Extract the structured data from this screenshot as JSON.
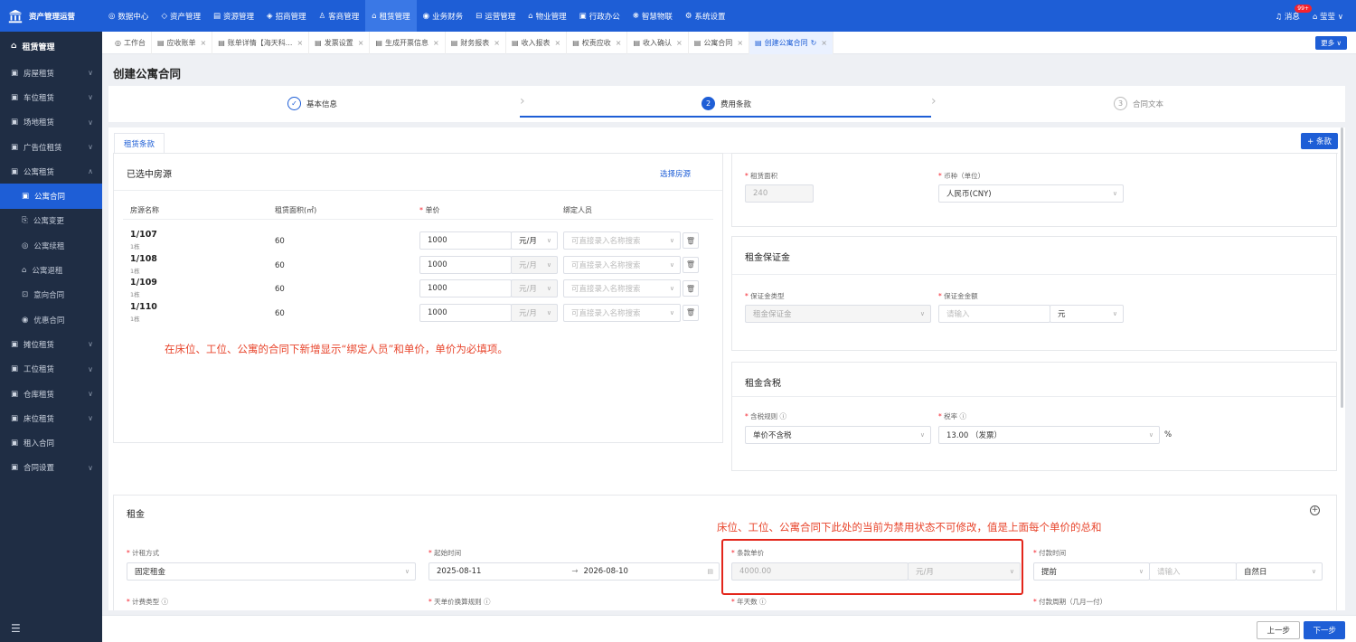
{
  "app": {
    "logo_text": "资产管理运营"
  },
  "topnav": [
    {
      "icon": "◎",
      "label": "数据中心"
    },
    {
      "icon": "◇",
      "label": "资产管理"
    },
    {
      "icon": "▤",
      "label": "资源管理"
    },
    {
      "icon": "◈",
      "label": "招商管理"
    },
    {
      "icon": "♙",
      "label": "客商管理"
    },
    {
      "icon": "⌂",
      "label": "租赁管理"
    },
    {
      "icon": "◉",
      "label": "业务财务"
    },
    {
      "icon": "⊟",
      "label": "运营管理"
    },
    {
      "icon": "⌂",
      "label": "物业管理"
    },
    {
      "icon": "▣",
      "label": "行政办公"
    },
    {
      "icon": "❋",
      "label": "智慧物联"
    },
    {
      "icon": "⚙",
      "label": "系统设置"
    }
  ],
  "topright": {
    "msg_label": "消息",
    "msg_count": "99+",
    "user": "莹莹"
  },
  "sidebar": {
    "header": "租赁管理",
    "items": [
      {
        "label": "房屋租赁",
        "chev": "∨"
      },
      {
        "label": "车位租赁",
        "chev": "∨"
      },
      {
        "label": "场地租赁",
        "chev": "∨"
      },
      {
        "label": "广告位租赁",
        "chev": "∨"
      },
      {
        "label": "公寓租赁",
        "chev": "∧"
      }
    ],
    "subs": [
      {
        "icon": "▣",
        "label": "公寓合同"
      },
      {
        "icon": "⎘",
        "label": "公寓变更"
      },
      {
        "icon": "◎",
        "label": "公寓续租"
      },
      {
        "icon": "⌂",
        "label": "公寓退租"
      },
      {
        "icon": "⊡",
        "label": "意向合同"
      },
      {
        "icon": "◉",
        "label": "优惠合同"
      }
    ],
    "items2": [
      {
        "label": "摊位租赁",
        "chev": "∨"
      },
      {
        "label": "工位租赁",
        "chev": "∨"
      },
      {
        "label": "仓库租赁",
        "chev": "∨"
      },
      {
        "label": "床位租赁",
        "chev": "∨"
      },
      {
        "label": "租入合同",
        "chev": ""
      },
      {
        "label": "合同设置",
        "chev": "∨"
      }
    ]
  },
  "tabs": [
    "工作台",
    "应收账单",
    "账单详情【海天科...",
    "发票设置",
    "生成开票信息",
    "财务报表",
    "收入报表",
    "权责应收",
    "收入确认",
    "公寓合同",
    "创建公寓合同"
  ],
  "more_label": "更多 ∨",
  "page_title": "创建公寓合同",
  "steps": [
    {
      "label": "基本信息",
      "num": "✓"
    },
    {
      "label": "费用条款",
      "num": "2"
    },
    {
      "label": "合同文本",
      "num": "3"
    }
  ],
  "subtab": "租赁条款",
  "add_label": "+ 条款",
  "rooms": {
    "title": "已选中房源",
    "select_link": "选择房源",
    "headers": [
      "房源名称",
      "租赁面积(㎡)",
      "单价",
      "绑定人员"
    ],
    "unit_options": "元/月",
    "person_placeholder": "可直接录入名称搜索",
    "rows": [
      {
        "name": "1/107",
        "building": "1栋",
        "area": "60",
        "price": "1000"
      },
      {
        "name": "1/108",
        "building": "1栋",
        "area": "60",
        "price": "1000"
      },
      {
        "name": "1/109",
        "building": "1栋",
        "area": "60",
        "price": "1000"
      },
      {
        "name": "1/110",
        "building": "1栋",
        "area": "60",
        "price": "1000"
      }
    ],
    "note": "在床位、工位、公寓的合同下新增显示“绑定人员”和单价，单价为必填项。"
  },
  "right": {
    "area_label": "租赁面积",
    "area_value": "240",
    "currency_label": "币种（单位）",
    "currency_value": "人民币(CNY)",
    "deposit_title": "租金保证金",
    "deposit_type_label": "保证金类型",
    "deposit_type_value": "租金保证金",
    "deposit_amt_label": "保证金金额",
    "deposit_amt_placeholder": "请输入",
    "deposit_unit": "元",
    "tax_title": "租金含税",
    "tax_rule_label": "含税规则",
    "tax_rule_value": "单价不含税",
    "tax_rate_label": "税率",
    "tax_rate_value": "13.00 （发票）",
    "tax_pct": "%"
  },
  "rent": {
    "title": "租金",
    "note": "床位、工位、公寓合同下此处的当前为禁用状态不可修改，值是上面每个单价的总和",
    "method_label": "计租方式",
    "method_value": "固定租金",
    "time_label": "起始时间",
    "start": "2025-08-11",
    "arrow": "→",
    "end": "2026-08-10",
    "price_label": "条款单价",
    "price_value": "4000.00",
    "price_unit": "元/月",
    "pay_label": "付款时间",
    "pay_value": "提前",
    "pay_placeholder": "请输入",
    "pay_unit": "自然日",
    "f1": "计费类型",
    "f2": "天单价换算规则",
    "f3": "年天数",
    "f4": "付款周期（几月一付）"
  },
  "buttons": {
    "prev": "上一步",
    "next": "下一步"
  }
}
